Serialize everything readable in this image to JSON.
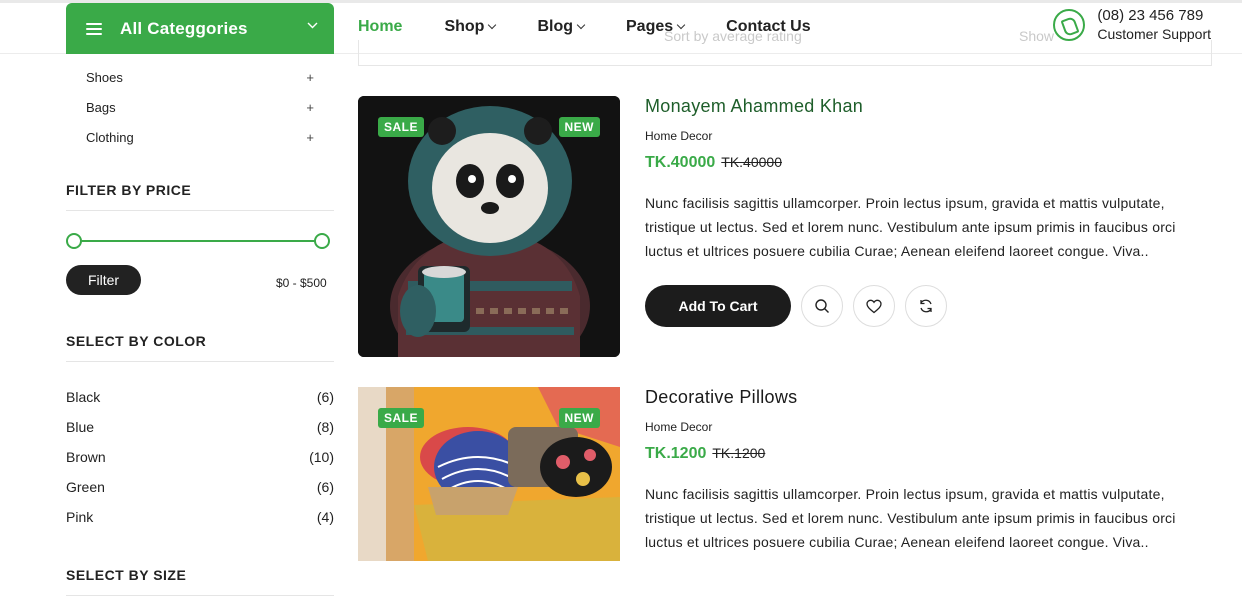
{
  "header": {
    "categories_label": "All Categgories",
    "nav": [
      {
        "label": "Home",
        "active": true,
        "dropdown": false
      },
      {
        "label": "Shop",
        "active": false,
        "dropdown": true
      },
      {
        "label": "Blog",
        "active": false,
        "dropdown": true
      },
      {
        "label": "Pages",
        "active": false,
        "dropdown": true
      },
      {
        "label": "Contact Us",
        "active": false,
        "dropdown": false
      }
    ],
    "phone": "(08) 23 456 789",
    "support_label": "Customer Support",
    "accent": "#3aaa48"
  },
  "toolbar": {
    "sort_label": "Sort by average rating",
    "show_label": "Show"
  },
  "sidebar": {
    "subcategories": [
      {
        "label": "Shoes",
        "toggle": "+"
      },
      {
        "label": "Bags",
        "toggle": "+"
      },
      {
        "label": "Clothing",
        "toggle": "+"
      }
    ],
    "price_title": "FILTER BY PRICE",
    "filter_button": "Filter",
    "price_range": "$0 - $500",
    "color_title": "SELECT BY COLOR",
    "colors": [
      {
        "label": "Black",
        "count": "(6)"
      },
      {
        "label": "Blue",
        "count": "(8)"
      },
      {
        "label": "Brown",
        "count": "(10)"
      },
      {
        "label": "Green",
        "count": "(6)"
      },
      {
        "label": "Pink",
        "count": "(4)"
      }
    ],
    "size_title": "SELECT BY SIZE"
  },
  "products": [
    {
      "title": "Monayem Ahammed Khan",
      "category": "Home Decor",
      "price": "TK.40000",
      "old_price": "TK.40000",
      "description": "Nunc facilisis sagittis ullamcorper. Proin lectus ipsum, gravida et mattis vulputate, tristique ut lectus. Sed et lorem nunc. Vestibulum ante ipsum primis in faucibus orci luctus et ultrices posuere cubilia Curae; Aenean eleifend laoreet congue. Viva..",
      "badge_sale": "SALE",
      "badge_new": "NEW",
      "cart_label": "Add To Cart"
    },
    {
      "title": "Decorative Pillows",
      "category": "Home Decor",
      "price": "TK.1200",
      "old_price": "TK.1200",
      "description": "Nunc facilisis sagittis ullamcorper. Proin lectus ipsum, gravida et mattis vulputate, tristique ut lectus. Sed et lorem nunc. Vestibulum ante ipsum primis in faucibus orci luctus et ultrices posuere cubilia Curae; Aenean eleifend laoreet congue. Viva..",
      "badge_sale": "SALE",
      "badge_new": "NEW"
    }
  ]
}
